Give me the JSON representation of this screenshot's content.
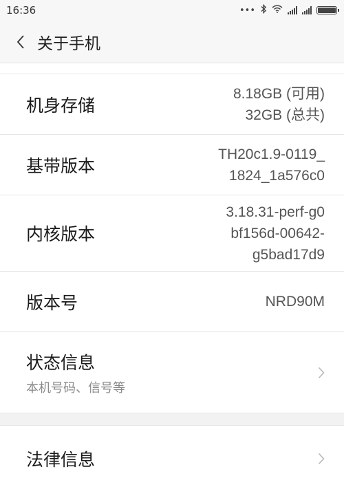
{
  "status_bar": {
    "time": "16:36",
    "icons": [
      "more-icon",
      "bluetooth-icon",
      "wifi-icon",
      "signal-icon",
      "signal-icon",
      "battery-icon"
    ]
  },
  "header": {
    "back_icon": "chevron-left-icon",
    "title": "关于手机"
  },
  "rows": {
    "storage": {
      "label": "机身存储",
      "value_line1": "8.18GB (可用)",
      "value_line2": "32GB (总共)"
    },
    "baseband": {
      "label": "基带版本",
      "value_line1": "TH20c1.9-0119_",
      "value_line2": "1824_1a576c0"
    },
    "kernel": {
      "label": "内核版本",
      "value_line1": "3.18.31-perf-g0",
      "value_line2": "bf156d-00642-",
      "value_line3": "g5bad17d9"
    },
    "build": {
      "label": "版本号",
      "value": "NRD90M"
    },
    "status_info": {
      "label": "状态信息",
      "sublabel": "本机号码、信号等",
      "icon": "chevron-right-icon"
    },
    "legal": {
      "label": "法律信息",
      "icon": "chevron-right-icon"
    }
  },
  "colors": {
    "background": "#f2f2f2",
    "card": "#ffffff",
    "divider": "#e6e6e6"
  }
}
